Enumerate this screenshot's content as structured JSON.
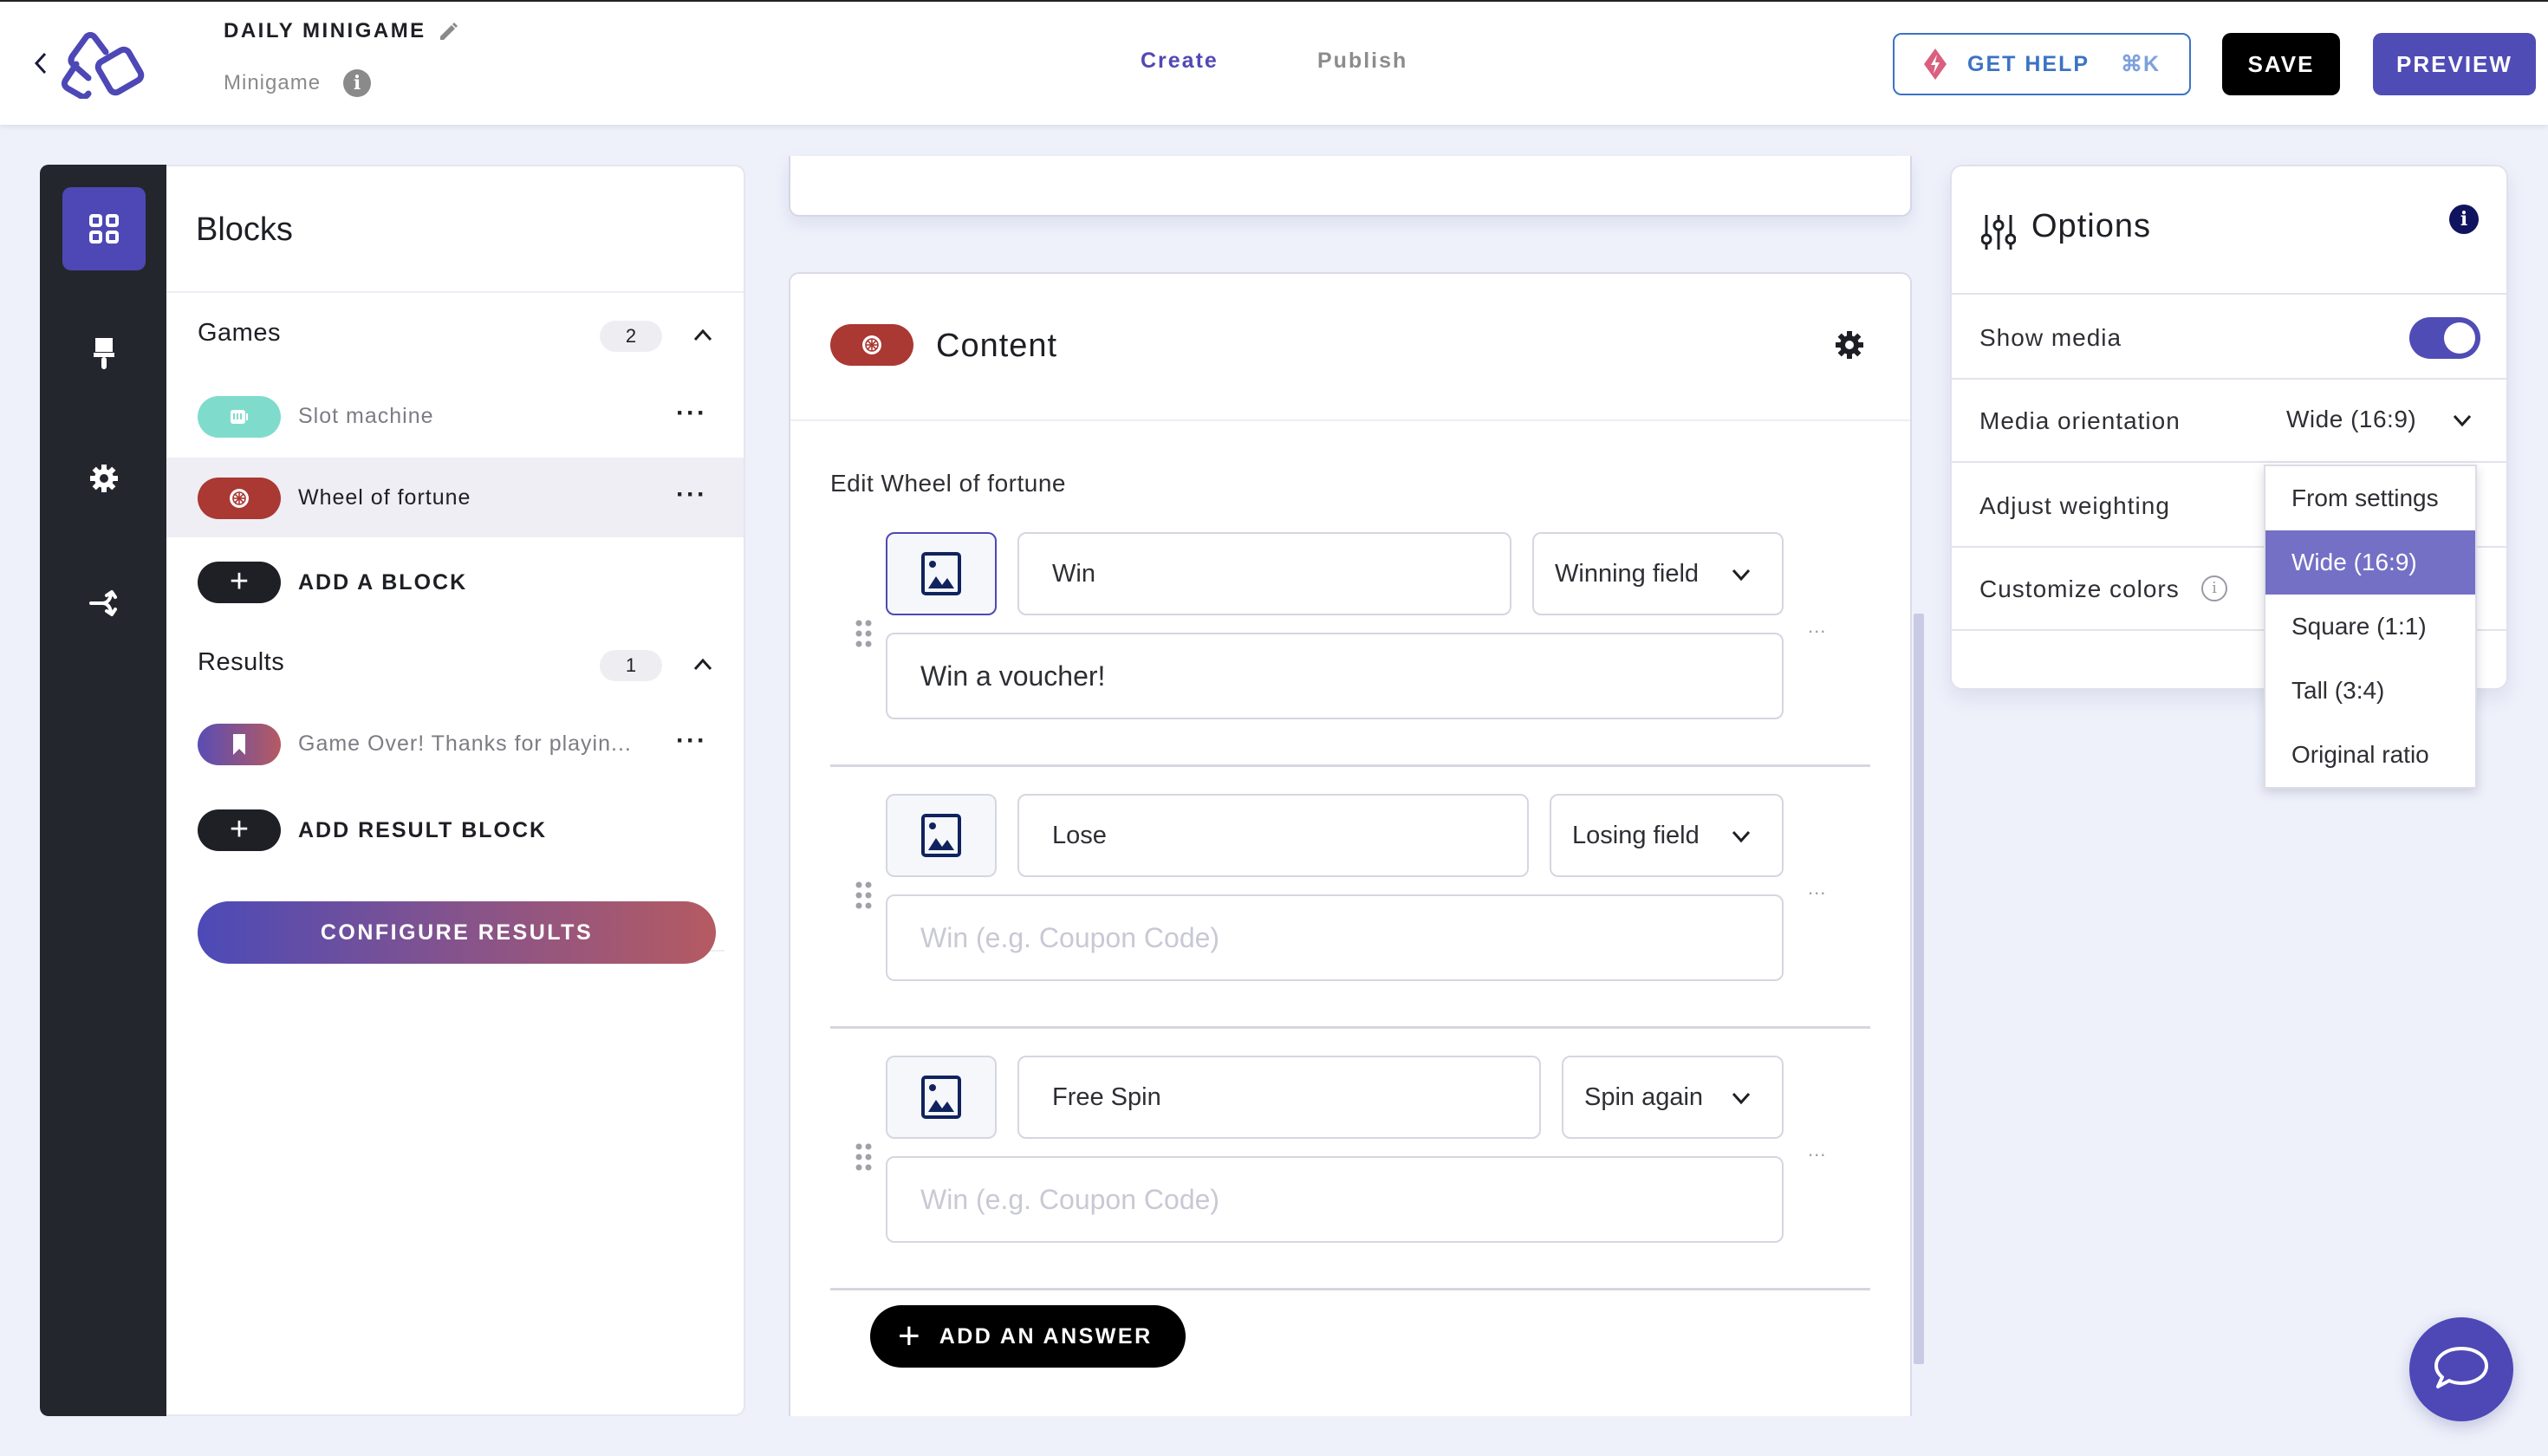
{
  "header": {
    "title": "DAILY MINIGAME",
    "subtitle": "Minigame",
    "tabs": [
      {
        "label": "Create",
        "active": true
      },
      {
        "label": "Publish",
        "active": false
      }
    ],
    "help_label": "GET HELP",
    "help_shortcut": "⌘K",
    "save_label": "SAVE",
    "preview_label": "PREVIEW"
  },
  "rail": {
    "items": [
      {
        "icon": "blocks-grid-icon",
        "active": true
      },
      {
        "icon": "paint-brush-icon",
        "active": false
      },
      {
        "icon": "gear-icon",
        "active": false
      },
      {
        "icon": "branch-icon",
        "active": false
      }
    ]
  },
  "blocks": {
    "title": "Blocks",
    "games": {
      "label": "Games",
      "count": "2",
      "items": [
        {
          "label": "Slot machine",
          "icon": "slot-machine-icon",
          "color": "#7fdccd",
          "selected": false
        },
        {
          "label": "Wheel of fortune",
          "icon": "wheel-icon",
          "color": "#aa3833",
          "selected": true
        }
      ],
      "add_label": "ADD A BLOCK"
    },
    "results": {
      "label": "Results",
      "count": "1",
      "items": [
        {
          "label": "Game Over! Thanks for playin...",
          "icon": "bookmark-icon"
        }
      ],
      "add_label": "ADD RESULT BLOCK"
    },
    "configure_label": "CONFIGURE RESULTS"
  },
  "content": {
    "title": "Content",
    "edit_label": "Edit Wheel of fortune",
    "answers": [
      {
        "name": "Win",
        "type": "Winning field",
        "prize_value": "Win a voucher!",
        "prize_placeholder": "Win (e.g. Coupon Code)"
      },
      {
        "name": "Lose",
        "type": "Losing field",
        "prize_value": "",
        "prize_placeholder": "Win (e.g. Coupon Code)"
      },
      {
        "name": "Free Spin",
        "type": "Spin again",
        "prize_value": "",
        "prize_placeholder": "Win (e.g. Coupon Code)"
      }
    ],
    "add_answer_label": "ADD AN ANSWER",
    "more_label": "..."
  },
  "options": {
    "title": "Options",
    "show_media_label": "Show media",
    "show_media_on": true,
    "media_orientation_label": "Media orientation",
    "media_orientation_value": "Wide (16:9)",
    "adjust_weighting_label": "Adjust weighting",
    "customize_colors_label": "Customize colors",
    "dropdown_options": [
      "From settings",
      "Wide (16:9)",
      "Square (1:1)",
      "Tall (3:4)",
      "Original ratio"
    ],
    "dropdown_selected": "Wide (16:9)"
  },
  "colors": {
    "accent": "#4f4cb6",
    "wheel_red": "#aa3833",
    "slot_teal": "#7fdccd",
    "help_blue": "#3b73c4"
  }
}
